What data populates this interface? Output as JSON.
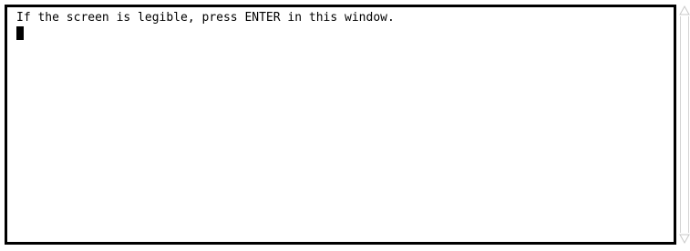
{
  "terminal": {
    "prompt_text": "If the screen is legible, press ENTER in this window."
  },
  "scrollbar": {
    "up_icon": "triangle-up",
    "down_icon": "triangle-down",
    "color": "#c8c8c8"
  },
  "colors": {
    "background": "#ffffff",
    "text": "#000000",
    "frame": "#000000"
  }
}
